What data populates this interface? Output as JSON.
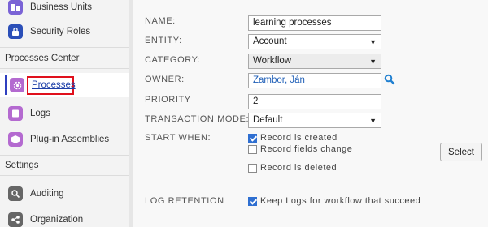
{
  "sidebar": {
    "items_top": [
      {
        "label": "Business Units",
        "icon": "business-units-icon",
        "color": "#6a5acd"
      },
      {
        "label": "Security Roles",
        "icon": "security-roles-icon",
        "color": "#2b4fb8"
      }
    ],
    "processes_center": {
      "heading": "Processes Center",
      "items": [
        {
          "label": "Processes",
          "icon": "processes-gear-icon",
          "color": "#b05fc6",
          "active": true
        },
        {
          "label": "Logs",
          "icon": "logs-icon",
          "color": "#b05fc6"
        },
        {
          "label": "Plug-in Assemblies",
          "icon": "plugin-assemblies-icon",
          "color": "#b05fc6"
        }
      ]
    },
    "settings": {
      "heading": "Settings",
      "items": [
        {
          "label": "Auditing",
          "icon": "auditing-icon",
          "color": "#666666"
        },
        {
          "label": "Organization",
          "icon": "organization-icon",
          "color": "#666666"
        }
      ]
    }
  },
  "form": {
    "name": {
      "label": "NAME:",
      "value": "learning processes"
    },
    "entity": {
      "label": "ENTITY:",
      "value": "Account"
    },
    "category": {
      "label": "CATEGORY:",
      "value": "Workflow"
    },
    "owner": {
      "label": "OWNER:",
      "value": "Zambor, Ján"
    },
    "priority": {
      "label": "PRIORITY",
      "value": "2"
    },
    "transaction_mode": {
      "label": "TRANSACTION MODE:",
      "value": "Default"
    },
    "start_when": {
      "label": "START WHEN:",
      "options": [
        {
          "label": "Record is created",
          "checked": true
        },
        {
          "label": "Record fields change",
          "checked": false
        },
        {
          "label": "Record is deleted",
          "checked": false
        }
      ],
      "select_button": "Select"
    },
    "log_retention": {
      "label": "LOG RETENTION",
      "option": {
        "label": "Keep Logs for workflow that succeed",
        "checked": true
      }
    }
  },
  "colors": {
    "accent": "#2f3fbf",
    "highlight": "#e0101c",
    "link": "#1f5fb7",
    "checkbox": "#2f6fd1"
  }
}
